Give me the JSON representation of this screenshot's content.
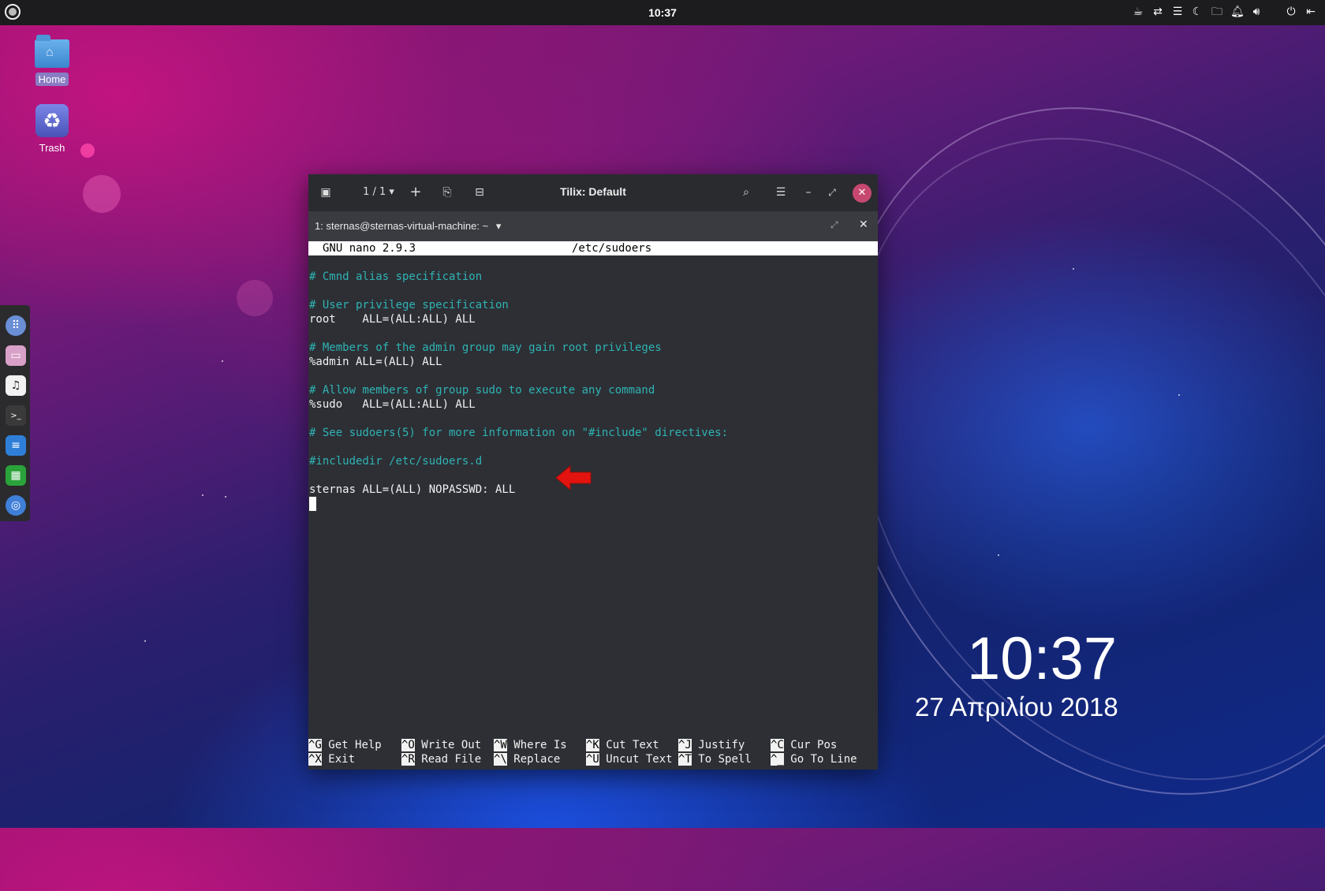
{
  "topbar": {
    "clock": "10:37",
    "tray_icons": [
      "coffee-icon",
      "network-icon",
      "menu-icon",
      "night-light-icon",
      "folder-icon",
      "notification-icon",
      "volume-icon",
      "power-icon",
      "logout-icon"
    ]
  },
  "desktop": {
    "icons": [
      {
        "label": "Home"
      },
      {
        "label": "Trash"
      }
    ]
  },
  "dock": {
    "items": [
      "app-grid-icon",
      "files-icon",
      "music-icon",
      "terminal-icon",
      "writer-icon",
      "calc-icon",
      "chrome-icon"
    ]
  },
  "window": {
    "page_indicator": "1 / 1",
    "title": "Tilix: Default",
    "tab_title": "1: sternas@sternas-virtual-machine: ~"
  },
  "nano": {
    "version": "GNU nano 2.9.3",
    "filename": "/etc/sudoers",
    "lines": [
      {
        "text": "# Cmnd alias specification",
        "type": "comment"
      },
      {
        "text": "# User privilege specification",
        "type": "comment"
      },
      {
        "text": "root    ALL=(ALL:ALL) ALL",
        "type": "normal"
      },
      {
        "text": "# Members of the admin group may gain root privileges",
        "type": "comment"
      },
      {
        "text": "%admin ALL=(ALL) ALL",
        "type": "normal"
      },
      {
        "text": "# Allow members of group sudo to execute any command",
        "type": "comment"
      },
      {
        "text": "%sudo   ALL=(ALL:ALL) ALL",
        "type": "normal"
      },
      {
        "text": "# See sudoers(5) for more information on \"#include\" directives:",
        "type": "comment"
      },
      {
        "text": "#includedir /etc/sudoers.d",
        "type": "comment"
      },
      {
        "text": "sternas ALL=(ALL) NOPASSWD: ALL",
        "type": "normal"
      }
    ],
    "shortcuts_row1": [
      {
        "key": "^G",
        "label": "Get Help"
      },
      {
        "key": "^O",
        "label": "Write Out"
      },
      {
        "key": "^W",
        "label": "Where Is"
      },
      {
        "key": "^K",
        "label": "Cut Text"
      },
      {
        "key": "^J",
        "label": "Justify"
      },
      {
        "key": "^C",
        "label": "Cur Pos"
      }
    ],
    "shortcuts_row2": [
      {
        "key": "^X",
        "label": "Exit"
      },
      {
        "key": "^R",
        "label": "Read File"
      },
      {
        "key": "^\\",
        "label": "Replace"
      },
      {
        "key": "^U",
        "label": "Uncut Text"
      },
      {
        "key": "^T",
        "label": "To Spell"
      },
      {
        "key": "^_",
        "label": "Go To Line"
      }
    ]
  },
  "desktop_clock": {
    "time": "10:37",
    "date": "27 Απριλίου 2018"
  },
  "colors": {
    "close_button": "#c64870",
    "comment_text": "#2fb3b3",
    "annotation_arrow": "#e3140f"
  }
}
